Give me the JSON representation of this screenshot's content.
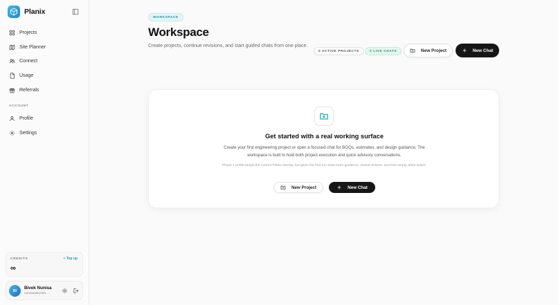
{
  "brand": {
    "name": "Planix",
    "accent": "#1e88c9"
  },
  "sidebar": {
    "items": [
      {
        "label": "Projects",
        "icon": "grid-icon"
      },
      {
        "label": "Site Planner",
        "icon": "map-icon"
      },
      {
        "label": "Connect",
        "icon": "users-icon"
      },
      {
        "label": "Usage",
        "icon": "document-icon"
      },
      {
        "label": "Referrals",
        "icon": "gift-icon"
      }
    ],
    "account_label": "ACCOUNT",
    "account_items": [
      {
        "label": "Profile",
        "icon": "user-icon"
      },
      {
        "label": "Settings",
        "icon": "gear-icon"
      }
    ],
    "credits": {
      "label": "CREDITS",
      "topup": "+ Top up",
      "value": "∞"
    },
    "user": {
      "initials": "BI",
      "name": "Bivek Nunisa",
      "email": "nunisaalex456..."
    }
  },
  "main": {
    "tag": "WORKSPACE",
    "title": "Workspace",
    "subtitle": "Create projects, continue revisions, and start guided chats from one place.",
    "stats": {
      "active_projects": "0 ACTIVE PROJECTS",
      "live_chats": "0 LIVE CHATS"
    },
    "buttons": {
      "new_project": "New Project",
      "new_chat": "New Chat"
    },
    "card": {
      "title": "Get started with a real working surface",
      "description": "Create your first engineering project or open a focused chat for BOQs, estimates, and design guidance. The workspace is built to hold both project execution and quick advisory conversations.",
      "note": "Phase 1 polish keeps the current Planix identity, but gives the first-run state more guidance, clearer actions, and less empty white space.",
      "new_project": "New Project",
      "new_chat": "New Chat"
    }
  },
  "colors": {
    "teal": "#1a8fa0",
    "green": "#23946a",
    "dark": "#161616"
  }
}
